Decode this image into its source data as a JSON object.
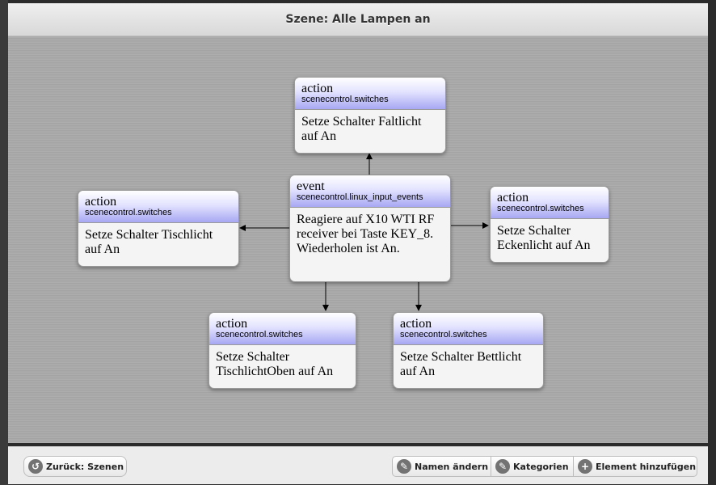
{
  "header": {
    "title": "Szene: Alle Lampen an"
  },
  "diagram": {
    "event": {
      "type": "event",
      "module": "scenecontrol.linux_input_events",
      "text": "Reagiere auf X10 WTI RF receiver bei Taste KEY_8. Wiederholen ist An."
    },
    "actions": [
      {
        "type": "action",
        "module": "scenecontrol.switches",
        "text": "Setze Schalter Faltlicht auf An"
      },
      {
        "type": "action",
        "module": "scenecontrol.switches",
        "text": "Setze Schalter Tischlicht auf An"
      },
      {
        "type": "action",
        "module": "scenecontrol.switches",
        "text": "Setze Schalter Eckenlicht auf An"
      },
      {
        "type": "action",
        "module": "scenecontrol.switches",
        "text": "Setze Schalter TischlichtOben auf An"
      },
      {
        "type": "action",
        "module": "scenecontrol.switches",
        "text": "Setze Schalter Bettlicht auf An"
      }
    ]
  },
  "footer": {
    "back_label": "Zurück: Szenen",
    "rename_label": "Namen ändern",
    "categories_label": "Kategorien",
    "add_element_label": "Element hinzufügen"
  },
  "icons": {
    "back": "back-arrow-icon",
    "rename": "pencil-icon",
    "categories": "pencil-icon",
    "add": "plus-icon"
  }
}
